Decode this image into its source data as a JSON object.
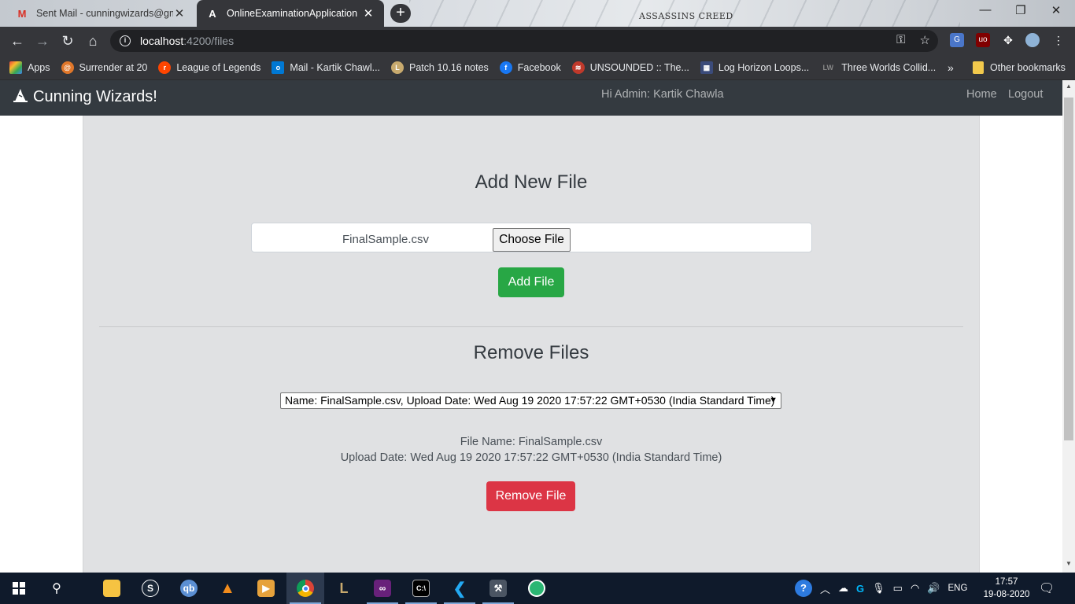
{
  "browser": {
    "tabs": [
      {
        "title": "Sent Mail - cunningwizards@gm",
        "icon": "gmail-icon"
      },
      {
        "title": "OnlineExaminationApplication",
        "icon": "angular-icon"
      }
    ],
    "wallpaper_text": "ASSASSINS CREED",
    "url_host": "localhost",
    "url_path": ":4200/files",
    "bookmarks": [
      {
        "label": "Apps",
        "icon": "apps-grid-icon",
        "color": "#e8453c"
      },
      {
        "label": "Surrender at 20",
        "icon": "surrender-icon",
        "color": "#e0772a"
      },
      {
        "label": "League of Legends",
        "icon": "reddit-icon",
        "color": "#ff4500"
      },
      {
        "label": "Mail - Kartik Chawl...",
        "icon": "outlook-icon",
        "color": "#0078d4"
      },
      {
        "label": "Patch 10.16 notes",
        "icon": "league-icon",
        "color": "#c8aa6e"
      },
      {
        "label": "Facebook",
        "icon": "facebook-icon",
        "color": "#1877f2"
      },
      {
        "label": "UNSOUNDED :: The...",
        "icon": "unsounded-icon",
        "color": "#c0392b"
      },
      {
        "label": "Log Horizon Loops...",
        "icon": "log-horizon-icon",
        "color": "#3b4b7a"
      },
      {
        "label": "Three Worlds Collid...",
        "icon": "lw-icon",
        "color": "#555555"
      }
    ],
    "other_bookmarks": "Other bookmarks"
  },
  "navbar": {
    "brand": "Cunning Wizards!",
    "greeting": "Hi Admin: Kartik Chawla",
    "home": "Home",
    "logout": "Logout"
  },
  "add_section": {
    "title": "Add New File",
    "file_name": "FinalSample.csv",
    "choose_label": "Choose File",
    "add_button": "Add File"
  },
  "remove_section": {
    "title": "Remove Files",
    "selected_option": "Name: FinalSample.csv, Upload Date: Wed Aug 19 2020 17:57:22 GMT+0530 (India Standard Time)",
    "file_name_line": "File Name: FinalSample.csv",
    "upload_date_line": "Upload Date: Wed Aug 19 2020 17:57:22 GMT+0530 (India Standard Time)",
    "remove_button": "Remove File"
  },
  "taskbar": {
    "language": "ENG",
    "time": "17:57",
    "date": "19-08-2020"
  },
  "colors": {
    "navbar": "#343a40",
    "card": "#e0e1e3",
    "success": "#28a745",
    "danger": "#dc3545"
  }
}
